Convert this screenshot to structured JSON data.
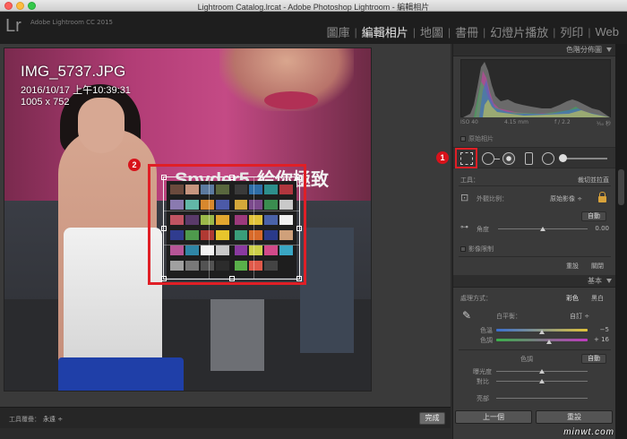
{
  "window": {
    "title": "Lightroom Catalog.lrcat - Adobe Photoshop Lightroom - 編輯相片"
  },
  "app": {
    "logo": "Lr",
    "version": "Adobe Lightroom CC 2015"
  },
  "modules": [
    {
      "label": "圖庫",
      "active": false
    },
    {
      "label": "編輯相片",
      "active": true
    },
    {
      "label": "地圖",
      "active": false
    },
    {
      "label": "書冊",
      "active": false
    },
    {
      "label": "幻燈片播放",
      "active": false
    },
    {
      "label": "列印",
      "active": false
    },
    {
      "label": "Web",
      "active": false
    }
  ],
  "image_info": {
    "filename": "IMG_5737.JPG",
    "datetime": "2016/10/17 上午10:39:31",
    "dimensions": "1005 x 752"
  },
  "photo_text": {
    "brand": "Spyder5",
    "slogan": "給你極致"
  },
  "callouts": {
    "one": "1",
    "two": "2"
  },
  "colorchecker": {
    "left": [
      "#6b4a3d",
      "#c6957f",
      "#5c7aa0",
      "#59673e",
      "#8a7ab0",
      "#62b7a7",
      "#d8882e",
      "#4c5aa8",
      "#c05462",
      "#5a3a6a",
      "#9bb94a",
      "#e3a72f",
      "#303c8f",
      "#4e9a4c",
      "#b03a33",
      "#e7c52c",
      "#b75597",
      "#2f86a6",
      "#f2f2f2",
      "#c8c8c8",
      "#a0a0a0",
      "#797979",
      "#535353",
      "#2c2c2c"
    ],
    "right": [
      "#3a3a3a",
      "#2e6ea8",
      "#2d8f8c",
      "#b0363e",
      "#d4a83a",
      "#7b4a8c",
      "#3a8d4f",
      "#c9c9c9",
      "#9c3a7c",
      "#e0c33a",
      "#4a62a8",
      "#f0f0f0",
      "#3a9d7a",
      "#d86a2a",
      "#2a3a8a",
      "#cfa07a",
      "#8a3aa0",
      "#ccd04a",
      "#d24a8a",
      "#3aa7c4",
      "#5ab04a",
      "#e05a4a",
      "#444444",
      "#1e1e1e"
    ]
  },
  "bottom_toolbar": {
    "overlay_label": "工具覆疊：",
    "overlay_value": "永遠 ÷",
    "done": "完成"
  },
  "histogram_panel": {
    "title": "色階分佈圖",
    "iso": "ISO 40",
    "focal": "4.15 mm",
    "aperture": "f / 2.2",
    "shutter": "¹⁄₅₀ 秒",
    "original_photo": "原始相片"
  },
  "crop_panel": {
    "tool_label": "工具：",
    "tool_value": "裁切並拉直",
    "aspect_label": "外觀比例：",
    "aspect_value": "原始影像 ÷",
    "angle_label": "角度",
    "angle_value": "0.00",
    "auto_button": "自動",
    "constrain_label": "影像限制",
    "reset": "重設",
    "close": "關閉"
  },
  "basic_panel": {
    "title": "基本",
    "treatment_label": "處理方式：",
    "color": "彩色",
    "bw": "黑白",
    "wb_label": "白平衡：",
    "wb_value": "自訂 ÷",
    "temp_label": "色溫",
    "temp_value": "−5",
    "tint_label": "色調",
    "tint_value": "+ 16",
    "tone_label": "色調",
    "tone_auto": "自動",
    "exposure_label": "曝光度",
    "contrast_label": "對比",
    "highlights_label": "亮部"
  },
  "nav": {
    "prev": "上一個",
    "reset": "重設"
  },
  "watermark": "minwt.com",
  "colors": {
    "accent_red": "#e01f26",
    "badge_red": "#d8121b",
    "panel_bg": "#3a3a3a"
  }
}
